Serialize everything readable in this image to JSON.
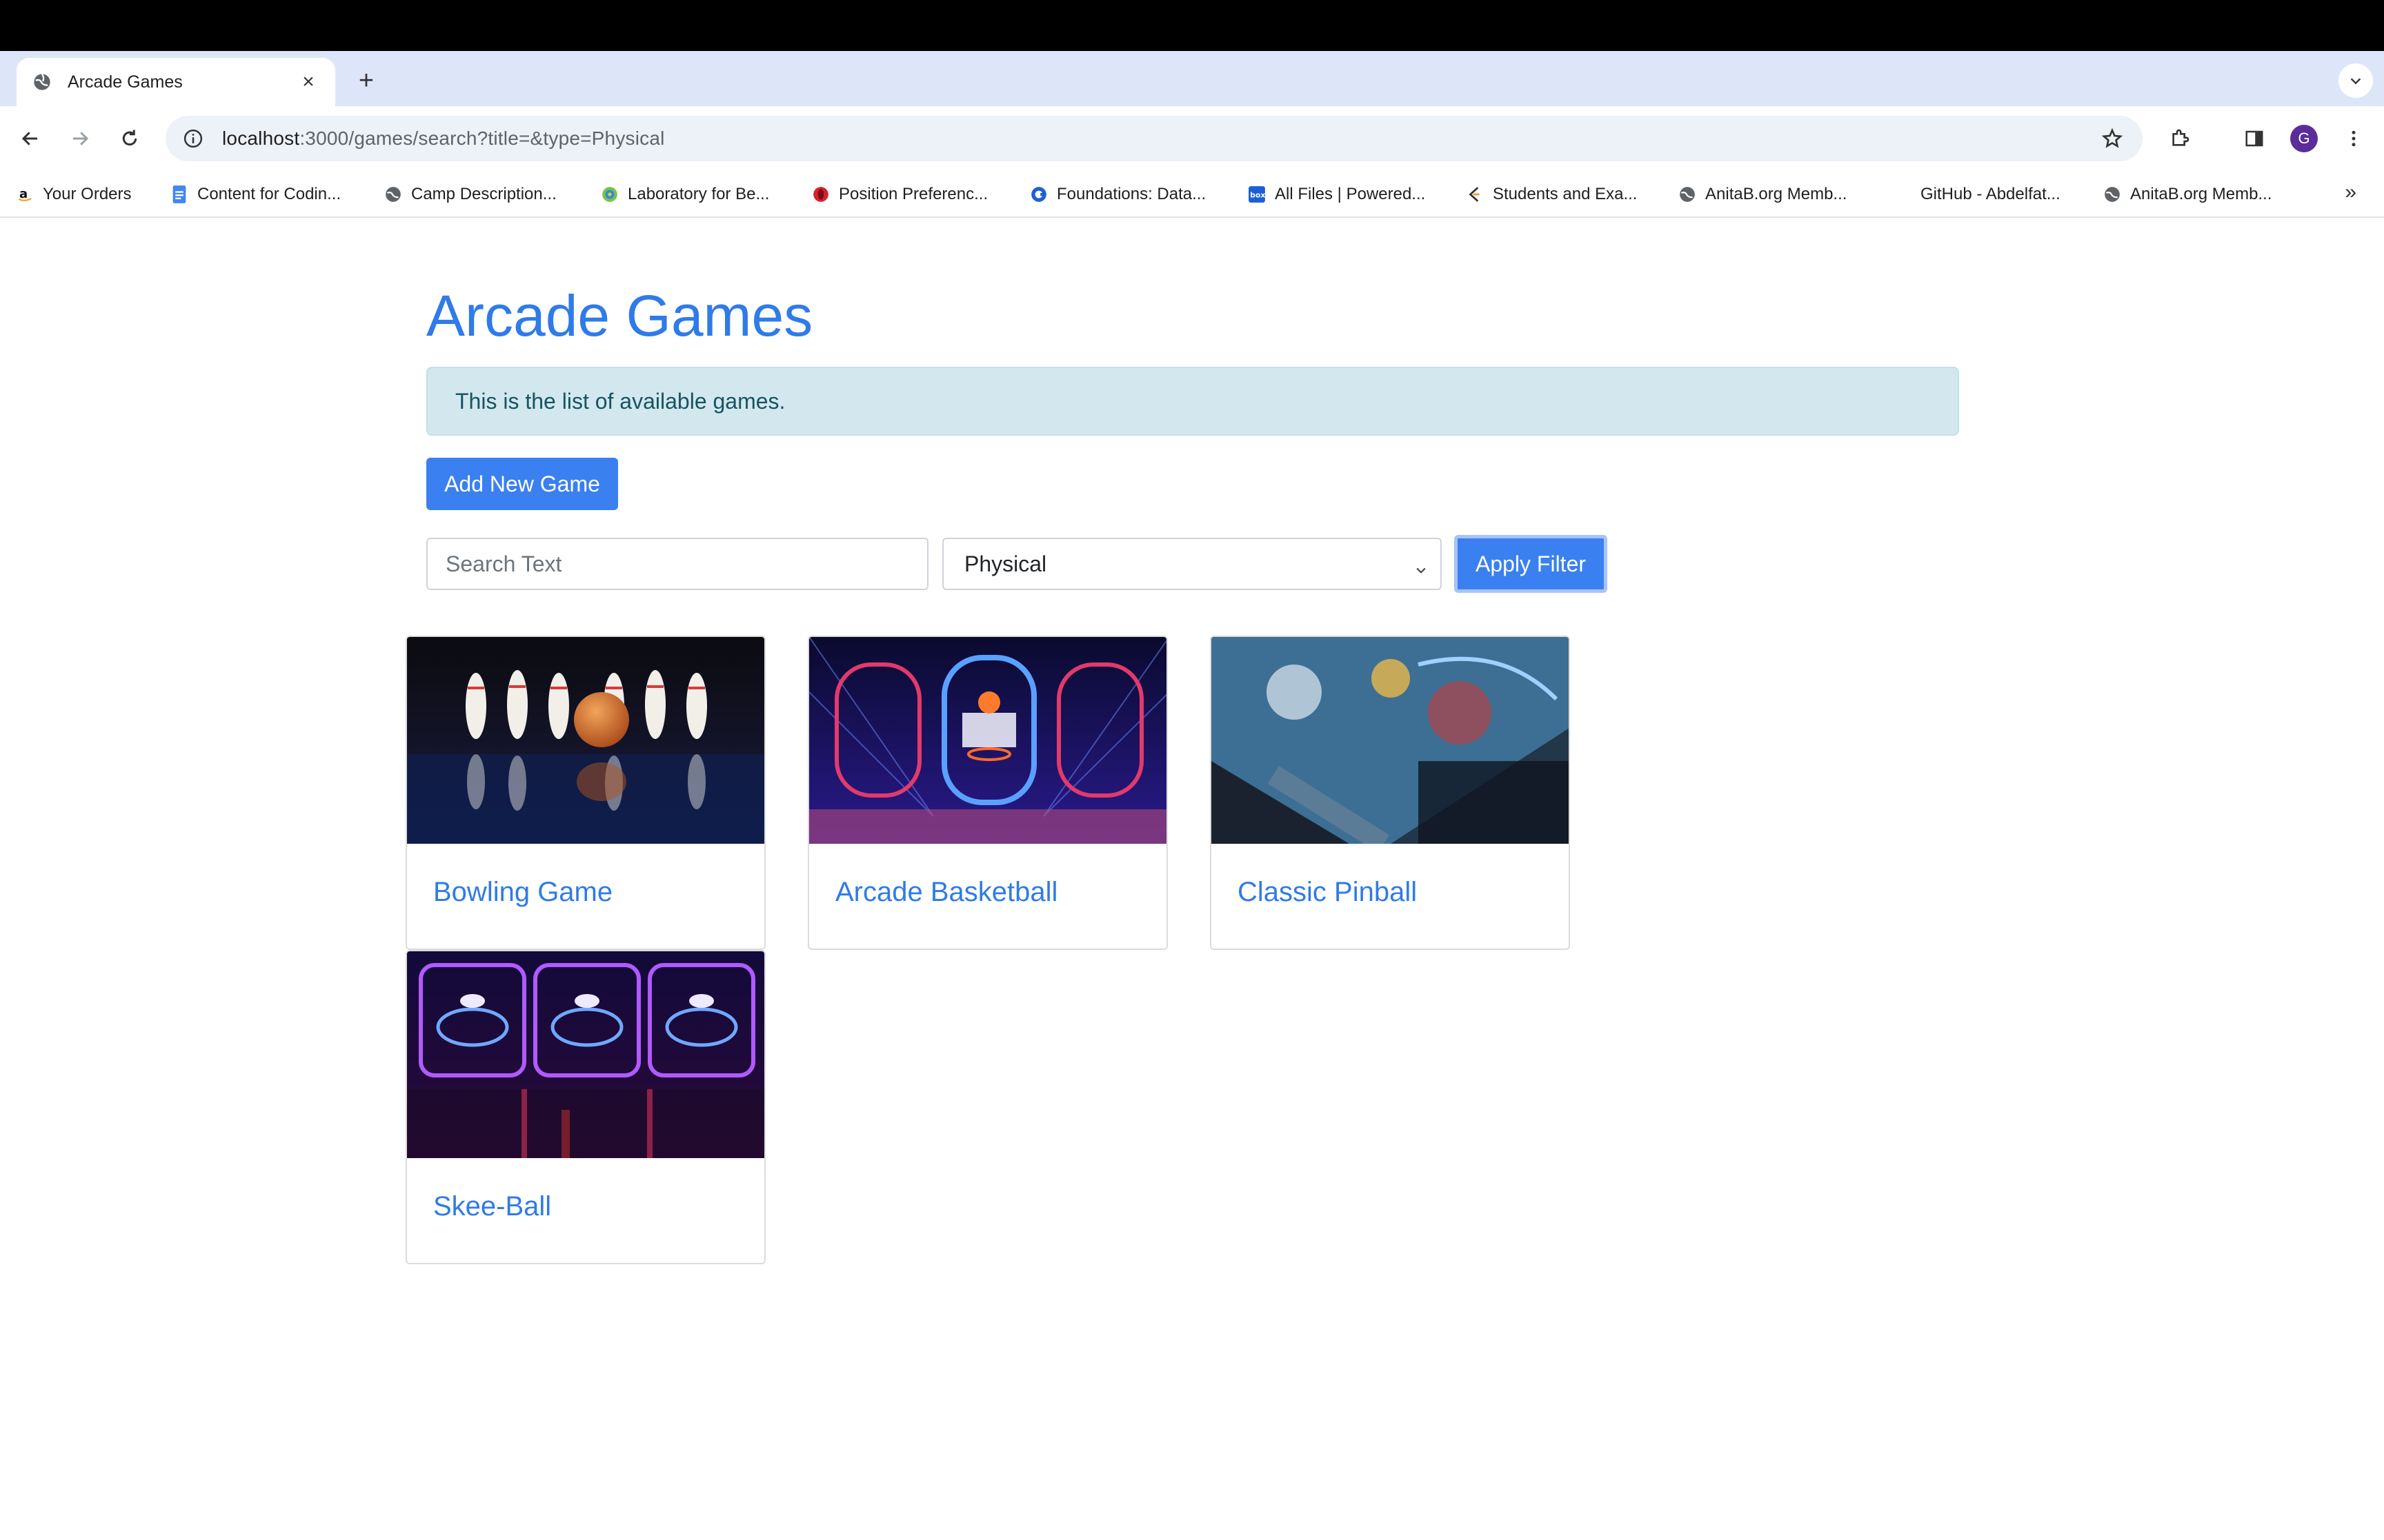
{
  "browser": {
    "tab_title": "Arcade Games",
    "url_host": "localhost",
    "url_path": ":3000/games/search?title=&type=Physical",
    "profile_initial": "G",
    "bookmarks": [
      {
        "label": "Your Orders",
        "icon": "amazon-icon"
      },
      {
        "label": "Content for Codin...",
        "icon": "docs-icon"
      },
      {
        "label": "Camp Description...",
        "icon": "globe-icon"
      },
      {
        "label": "Laboratory for Be...",
        "icon": "site-icon"
      },
      {
        "label": "Position Preferenc...",
        "icon": "opera-icon"
      },
      {
        "label": "Foundations: Data...",
        "icon": "coursera-icon"
      },
      {
        "label": "All Files | Powered...",
        "icon": "box-icon"
      },
      {
        "label": "Students and Exa...",
        "icon": "ed-icon"
      },
      {
        "label": "AnitaB.org Memb...",
        "icon": "globe-icon"
      },
      {
        "label": "GitHub - Abdelfat...",
        "icon": "none"
      },
      {
        "label": "AnitaB.org Memb...",
        "icon": "globe-icon"
      }
    ]
  },
  "page": {
    "title": "Arcade Games",
    "alert": "This is the list of available games.",
    "add_button": "Add New Game",
    "search_placeholder": "Search Text",
    "type_selected": "Physical",
    "apply_button": "Apply Filter"
  },
  "games": [
    {
      "title": "Bowling Game"
    },
    {
      "title": "Arcade Basketball"
    },
    {
      "title": "Classic Pinball"
    },
    {
      "title": "Skee-Ball"
    }
  ],
  "colors": {
    "accent": "#2f7be8",
    "button": "#3a80f0",
    "alert_bg": "#d3e8ee",
    "alert_text": "#165461"
  }
}
